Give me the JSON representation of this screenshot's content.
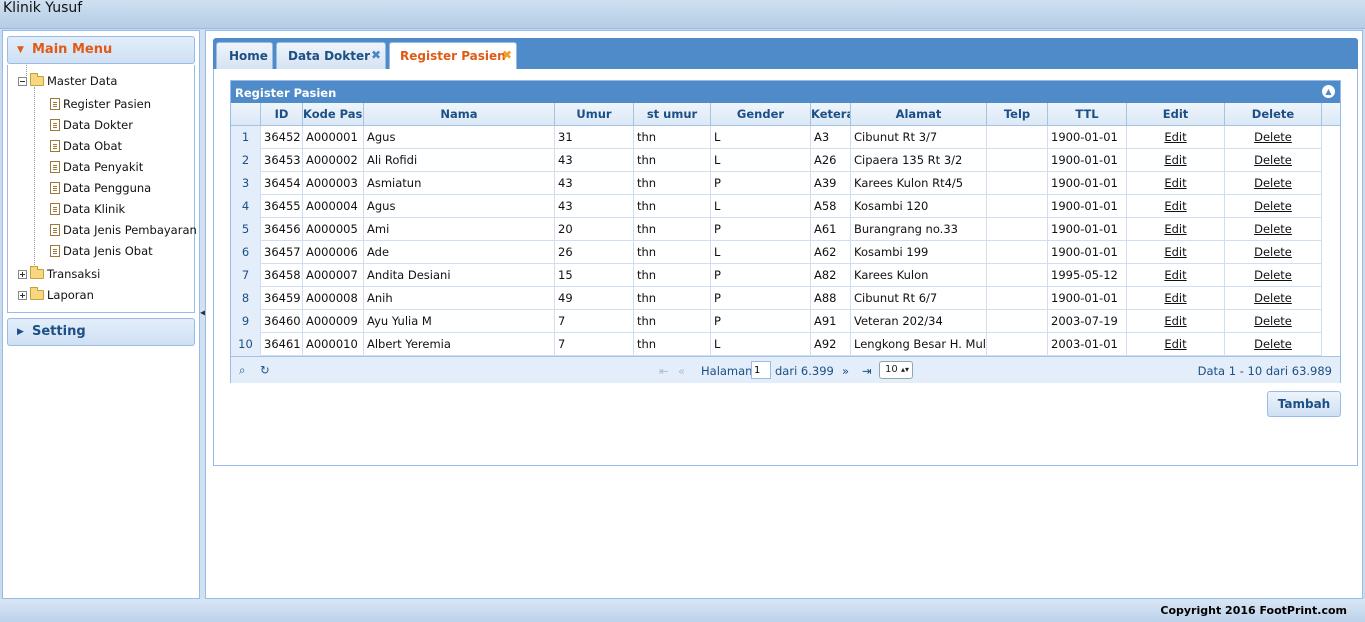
{
  "app": {
    "title": "Klinik Yusuf"
  },
  "sidebar": {
    "main_menu": "Main Menu",
    "setting": "Setting",
    "tree": {
      "master_data": "Master Data",
      "items": [
        "Register Pasien",
        "Data Dokter",
        "Data Obat",
        "Data Penyakit",
        "Data Pengguna",
        "Data Klinik",
        "Data Jenis Pembayaran",
        "Data Jenis Obat"
      ],
      "transaksi": "Transaksi",
      "laporan": "Laporan"
    }
  },
  "tabs": [
    {
      "label": "Home",
      "closable": false
    },
    {
      "label": "Data Dokter",
      "closable": true
    },
    {
      "label": "Register Pasien",
      "closable": true,
      "active": true
    }
  ],
  "grid": {
    "title": "Register Pasien",
    "columns": [
      "ID",
      "Kode Pasi",
      "Nama",
      "Umur",
      "st umur",
      "Gender",
      "Ketera",
      "Alamat",
      "Telp",
      "TTL",
      "Edit",
      "Delete"
    ],
    "rows": [
      [
        "1",
        "36452",
        "A000001",
        "Agus",
        "31",
        "thn",
        "L",
        "A3",
        "Cibunut Rt 3/7",
        "",
        "1900-01-01",
        "Edit",
        "Delete"
      ],
      [
        "2",
        "36453",
        "A000002",
        "Ali Rofidi",
        "43",
        "thn",
        "L",
        "A26",
        "Cipaera 135 Rt 3/2",
        "",
        "1900-01-01",
        "Edit",
        "Delete"
      ],
      [
        "3",
        "36454",
        "A000003",
        "Asmiatun",
        "43",
        "thn",
        "P",
        "A39",
        "Karees Kulon Rt4/5",
        "",
        "1900-01-01",
        "Edit",
        "Delete"
      ],
      [
        "4",
        "36455",
        "A000004",
        "Agus",
        "43",
        "thn",
        "L",
        "A58",
        "Kosambi 120",
        "",
        "1900-01-01",
        "Edit",
        "Delete"
      ],
      [
        "5",
        "36456",
        "A000005",
        "Ami",
        "20",
        "thn",
        "P",
        "A61",
        "Burangrang no.33",
        "",
        "1900-01-01",
        "Edit",
        "Delete"
      ],
      [
        "6",
        "36457",
        "A000006",
        "Ade",
        "26",
        "thn",
        "L",
        "A62",
        "Kosambi 199",
        "",
        "1900-01-01",
        "Edit",
        "Delete"
      ],
      [
        "7",
        "36458",
        "A000007",
        "Andita Desiani",
        "15",
        "thn",
        "P",
        "A82",
        "Karees Kulon",
        "",
        "1995-05-12",
        "Edit",
        "Delete"
      ],
      [
        "8",
        "36459",
        "A000008",
        "Anih",
        "49",
        "thn",
        "P",
        "A88",
        "Cibunut Rt 6/7",
        "",
        "1900-01-01",
        "Edit",
        "Delete"
      ],
      [
        "9",
        "36460",
        "A000009",
        "Ayu Yulia M",
        "7",
        "thn",
        "P",
        "A91",
        "Veteran 202/34",
        "",
        "2003-07-19",
        "Edit",
        "Delete"
      ],
      [
        "10",
        "36461",
        "A000010",
        "Albert Yeremia",
        "7",
        "thn",
        "L",
        "A92",
        "Lengkong Besar H. Mulyadi",
        "",
        "2003-01-01",
        "Edit",
        "Delete"
      ]
    ],
    "pager": {
      "halaman_label": "Halaman",
      "page": "1",
      "of_label": "dari 6.399",
      "page_size": "10",
      "info": "Data 1 - 10 dari 63.989"
    }
  },
  "buttons": {
    "tambah": "Tambah"
  },
  "footer": {
    "copyright": "Copyright 2016 FootPrint.com"
  },
  "colors": {
    "accent": "#4e8bc8",
    "active_tab_text": "#e05b15",
    "link_text": "#1d4f84"
  }
}
